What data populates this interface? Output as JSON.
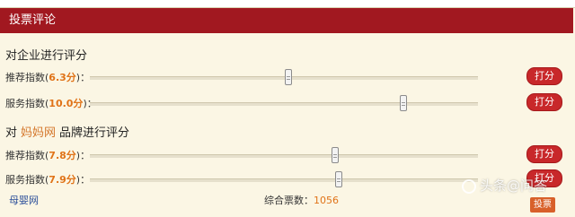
{
  "header": {
    "title": "投票评论"
  },
  "section1": {
    "title": "对企业进行评分",
    "rows": [
      {
        "label_prefix": "推荐指数(",
        "score": "6.3分",
        "label_suffix": ")：",
        "button": "打分",
        "value": 6.3
      },
      {
        "label_prefix": "服务指数(",
        "score": "10.0分",
        "label_suffix": ")：",
        "button": "打分",
        "value": 10.0
      }
    ]
  },
  "section2": {
    "title_prefix": "对",
    "brand": "妈妈网",
    "title_suffix": "品牌进行评分",
    "rows": [
      {
        "label_prefix": "推荐指数(",
        "score": "7.8分",
        "label_suffix": ")：",
        "button": "打分",
        "value": 7.8
      },
      {
        "label_prefix": "服务指数(",
        "score": "7.9分",
        "label_suffix": ")：",
        "button": "打分",
        "value": 7.9
      }
    ]
  },
  "footer": {
    "site_name": "母婴网",
    "total_label": "综合票数：",
    "total_value": "1056",
    "vote_button": "投票"
  },
  "watermark": {
    "text": "头条@问答"
  },
  "colors": {
    "header_bg": "#a11820",
    "panel_bg": "#fbf6e4",
    "score": "#e07318",
    "button": "#c8282a"
  }
}
